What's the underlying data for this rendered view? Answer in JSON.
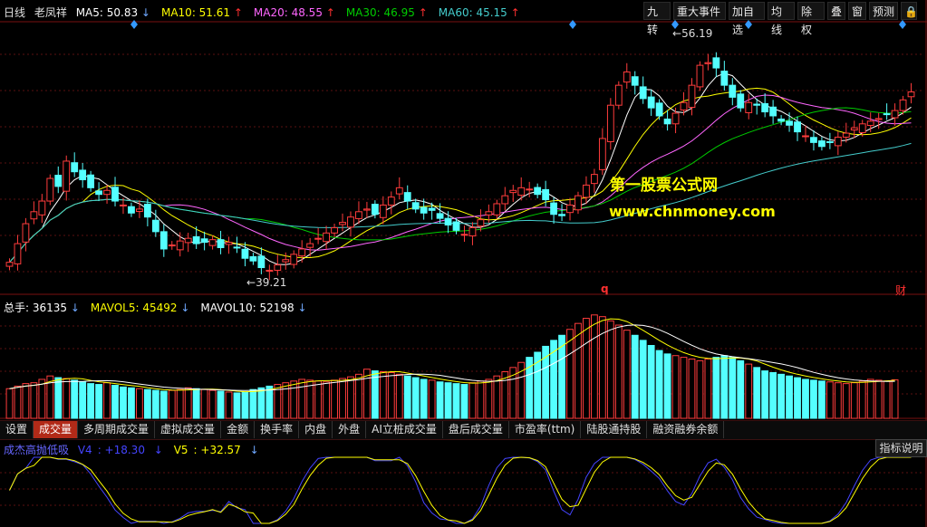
{
  "header": {
    "period": "日线",
    "stock": "老凤祥",
    "ma": [
      {
        "label": "MA5",
        "value": "50.83",
        "arrow": "↓",
        "color": "#ffffff"
      },
      {
        "label": "MA10",
        "value": "51.61",
        "arrow": "↑",
        "color": "#ffff00"
      },
      {
        "label": "MA20",
        "value": "48.55",
        "arrow": "↑",
        "color": "#ff66ff"
      },
      {
        "label": "MA30",
        "value": "46.95",
        "arrow": "↑",
        "color": "#00cc00"
      },
      {
        "label": "MA60",
        "value": "45.15",
        "arrow": "↑",
        "color": "#44cccc"
      }
    ]
  },
  "toolbar": [
    "九转",
    "重大事件",
    "加自选",
    "均线",
    "除权",
    "叠",
    "窗",
    "预测",
    "🔒"
  ],
  "annotations": {
    "high": "56.19",
    "low": "39.21",
    "mark_q": "q",
    "mark_cai": "财"
  },
  "watermark": {
    "line1": "第一股票公式网",
    "line2": "www.chnmoney.com"
  },
  "volume_header": [
    {
      "label": "总手",
      "value": "36135",
      "arrow": "↓",
      "color": "#ffffff"
    },
    {
      "label": "MAVOL5",
      "value": "45492",
      "arrow": "↓",
      "color": "#ffff00"
    },
    {
      "label": "MAVOL10",
      "value": "52198",
      "arrow": "↓",
      "color": "#ffffff"
    }
  ],
  "tabs": [
    "设置",
    "成交量",
    "多周期成交量",
    "虚拟成交量",
    "金额",
    "换手率",
    "内盘",
    "外盘",
    "AI立桩成交量",
    "盘后成交量",
    "市盈率(ttm)",
    "陆股通持股",
    "融资融券余额"
  ],
  "selected_tab": "成交量",
  "indicator": {
    "name": "成杰高抛低吸",
    "v4_label": "V4",
    "v4_value": "+18.30",
    "v4_arrow": "↓",
    "v5_label": "V5",
    "v5_value": "+32.57",
    "v5_arrow": "↓",
    "explain_button": "指标说明"
  },
  "chart_data": {
    "type": "candlestick",
    "ylim": [
      38,
      58
    ],
    "close": [
      40.2,
      41.6,
      43.1,
      44.0,
      44.8,
      46.5,
      45.9,
      47.8,
      47.0,
      46.4,
      45.8,
      45.3,
      45.6,
      44.8,
      44.5,
      43.9,
      44.2,
      43.6,
      42.5,
      41.2,
      41.5,
      41.8,
      42.0,
      41.6,
      41.7,
      41.9,
      41.3,
      41.7,
      41.3,
      40.5,
      40.3,
      39.8,
      39.6,
      40.0,
      40.4,
      40.8,
      41.2,
      41.6,
      42.0,
      42.4,
      42.8,
      43.2,
      43.6,
      44.0,
      44.2,
      43.8,
      44.5,
      45.1,
      45.8,
      44.8,
      44.2,
      43.9,
      44.1,
      43.5,
      43.0,
      42.6,
      42.3,
      42.8,
      43.4,
      44.0,
      44.6,
      45.2,
      45.6,
      45.8,
      45.7,
      45.3,
      44.9,
      43.8,
      43.7,
      44.5,
      45.2,
      46.0,
      46.8,
      49.5,
      52.0,
      53.5,
      54.5,
      53.5,
      52.5,
      51.8,
      51.2,
      50.6,
      51.4,
      52.2,
      53.5,
      55.0,
      55.2,
      54.8,
      53.5,
      52.6,
      51.8,
      52.2,
      52.0,
      51.5,
      51.2,
      50.8,
      50.5,
      50.0,
      49.7,
      49.2,
      48.9,
      49.2,
      49.6,
      49.9,
      50.3,
      50.6,
      50.8,
      51.0,
      51.3,
      51.6,
      52.4,
      53.0
    ],
    "volume": [
      35000,
      38000,
      41000,
      42000,
      46000,
      50000,
      48000,
      47000,
      45000,
      43000,
      41000,
      40000,
      42000,
      39000,
      37000,
      36000,
      35000,
      34000,
      33000,
      32000,
      33000,
      34000,
      36000,
      35000,
      34000,
      33000,
      32000,
      31000,
      30000,
      31000,
      34000,
      36000,
      38000,
      40000,
      42000,
      44000,
      46000,
      45000,
      44000,
      43000,
      45000,
      47000,
      49000,
      52000,
      58000,
      56000,
      55000,
      54000,
      52000,
      50000,
      48000,
      46000,
      45000,
      43000,
      42000,
      41000,
      40000,
      42000,
      44000,
      46000,
      50000,
      55000,
      60000,
      66000,
      72000,
      78000,
      85000,
      92000,
      98000,
      105000,
      112000,
      118000,
      122000,
      120000,
      115000,
      110000,
      104000,
      98000,
      92000,
      86000,
      80000,
      76000,
      74000,
      72000,
      70000,
      68000,
      70000,
      72000,
      74000,
      72000,
      68000,
      64000,
      60000,
      56000,
      54000,
      52000,
      50000,
      48000,
      46000,
      45000,
      44000,
      43000,
      42000,
      41000,
      42000,
      44000,
      46000,
      45000,
      44000,
      45492
    ],
    "vol_ylim": [
      0,
      125000
    ],
    "osc_ylim": [
      0,
      100
    ]
  }
}
